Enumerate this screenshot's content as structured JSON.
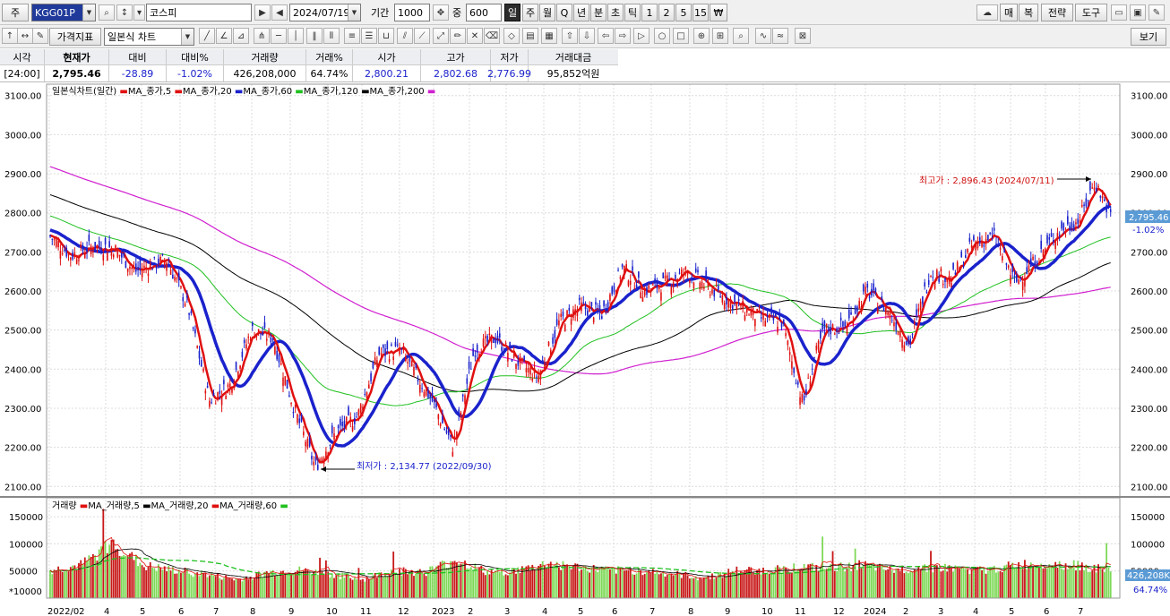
{
  "toolbar1": {
    "type_label": "주",
    "code_value": "KGG01P",
    "name_value": "코스피",
    "date_value": "2024/07/19",
    "period_label": "기간",
    "period_value": "1000",
    "zoom_label": "중",
    "zoom_value": "600",
    "periods": [
      "일",
      "주",
      "월",
      "Q",
      "년",
      "분",
      "초",
      "틱",
      "1",
      "2",
      "5",
      "15",
      "₩"
    ],
    "right_buttons": [
      "매",
      "복",
      "전략",
      "도구"
    ]
  },
  "toolbar2": {
    "indicator_label": "가격지표",
    "chart_type_value": "일본식 차트",
    "view_label": "보기"
  },
  "quote": {
    "headers": [
      "시각",
      "현재가",
      "대비",
      "대비%",
      "거래량",
      "거래%",
      "시가",
      "고가",
      "저가",
      "거래대금"
    ],
    "values": [
      "[24:00]",
      "2,795.46",
      "-28.89",
      "-1.02%",
      "426,208,000",
      "64.74%",
      "2,800.21",
      "2,802.68",
      "2,776.99",
      "95,852억원"
    ]
  },
  "price_legend": {
    "title": "일본식차트(일간)",
    "items": [
      {
        "label": "MA_종가,5",
        "color": "#e01010"
      },
      {
        "label": "MA_종가,20",
        "color": "#e01010"
      },
      {
        "label": "MA_종가,60",
        "color": "#1a22cc"
      },
      {
        "label": "MA_종가,120",
        "color": "#20c020"
      },
      {
        "label": "MA_종가,200",
        "color": "#d020d0"
      }
    ]
  },
  "volume_legend": {
    "title": "거래량",
    "items": [
      {
        "label": "MA_거래량,5",
        "color": "#e01010"
      },
      {
        "label": "MA_거래량,20",
        "color": "#000000"
      },
      {
        "label": "MA_거래량,60",
        "color": "#e01010"
      }
    ],
    "unit_label": "*10000"
  },
  "annotations": {
    "high_text": "최고가 : 2,896.43 (2024/07/11)",
    "low_text": "최저가 : 2,134.77 (2022/09/30)",
    "current_price_label": "2,795.46",
    "current_change_label": "-1.02%",
    "current_volume_label": "426,208K",
    "current_volume_pct_label": "64.74%"
  },
  "colors": {
    "up": "#e01010",
    "down": "#1a22cc",
    "ma5": "#e01010",
    "ma20": "#1a22cc",
    "ma60": "#20c020",
    "ma120": "#000000",
    "ma200": "#d020d0",
    "vol_up": "#c81818",
    "vol_green": "#7ed957"
  },
  "chart_data": {
    "type": "candlestick",
    "series": [
      {
        "name": "MA_종가,5",
        "values": []
      },
      {
        "name": "MA_종가,20",
        "values": []
      },
      {
        "name": "MA_종가,60",
        "values": []
      },
      {
        "name": "MA_종가,120",
        "values": []
      },
      {
        "name": "MA_종가,200",
        "values": []
      }
    ],
    "price_axis": {
      "ylim": [
        2080,
        3120
      ],
      "ticks": [
        "3100.00",
        "3000.00",
        "2900.00",
        "2800.00",
        "2700.00",
        "2600.00",
        "2500.00",
        "2400.00",
        "2300.00",
        "2200.00",
        "2100.00"
      ]
    },
    "volume_axis": {
      "ylim": [
        0,
        175000
      ],
      "ticks": [
        "150000",
        "100000",
        "50000"
      ]
    },
    "x_axis_labels": [
      "2022/02",
      "4",
      "5",
      "6",
      "7",
      "8",
      "9",
      "10",
      "11",
      "12",
      "2023",
      "2",
      "3",
      "4",
      "5",
      "6",
      "7",
      "8",
      "9",
      "10",
      "11",
      "12",
      "2024",
      "2",
      "3",
      "4",
      "5",
      "6",
      "7"
    ],
    "close_path": {
      "t": [
        0,
        0.02,
        0.04,
        0.06,
        0.08,
        0.11,
        0.13,
        0.15,
        0.17,
        0.19,
        0.21,
        0.23,
        0.25,
        0.27,
        0.29,
        0.31,
        0.33,
        0.36,
        0.38,
        0.4,
        0.42,
        0.44,
        0.46,
        0.48,
        0.5,
        0.52,
        0.54,
        0.56,
        0.58,
        0.6,
        0.62,
        0.65,
        0.67,
        0.69,
        0.71,
        0.72,
        0.73,
        0.75,
        0.77,
        0.79,
        0.81,
        0.83,
        0.85,
        0.87,
        0.89,
        0.91,
        0.93,
        0.95,
        0.97,
        0.985,
        1.0
      ],
      "v": [
        2740,
        2690,
        2715,
        2710,
        2650,
        2680,
        2560,
        2320,
        2360,
        2500,
        2480,
        2300,
        2150,
        2240,
        2280,
        2440,
        2450,
        2320,
        2200,
        2450,
        2480,
        2420,
        2380,
        2520,
        2560,
        2540,
        2660,
        2600,
        2620,
        2650,
        2610,
        2560,
        2530,
        2520,
        2310,
        2420,
        2500,
        2510,
        2600,
        2550,
        2460,
        2650,
        2630,
        2720,
        2740,
        2620,
        2680,
        2750,
        2780,
        2880,
        2795
      ]
    },
    "volume_level": [
      0.3,
      0.36,
      0.6,
      0.35,
      0.3,
      0.26,
      0.2,
      0.28,
      0.3,
      0.26,
      0.2,
      0.3,
      0.28,
      0.42,
      0.28,
      0.3,
      0.38,
      0.33,
      0.3,
      0.3,
      0.26,
      0.22,
      0.3,
      0.3,
      0.34,
      0.32,
      0.36,
      0.3,
      0.34,
      0.32,
      0.3,
      0.36,
      0.38,
      0.35,
      0.3
    ]
  }
}
